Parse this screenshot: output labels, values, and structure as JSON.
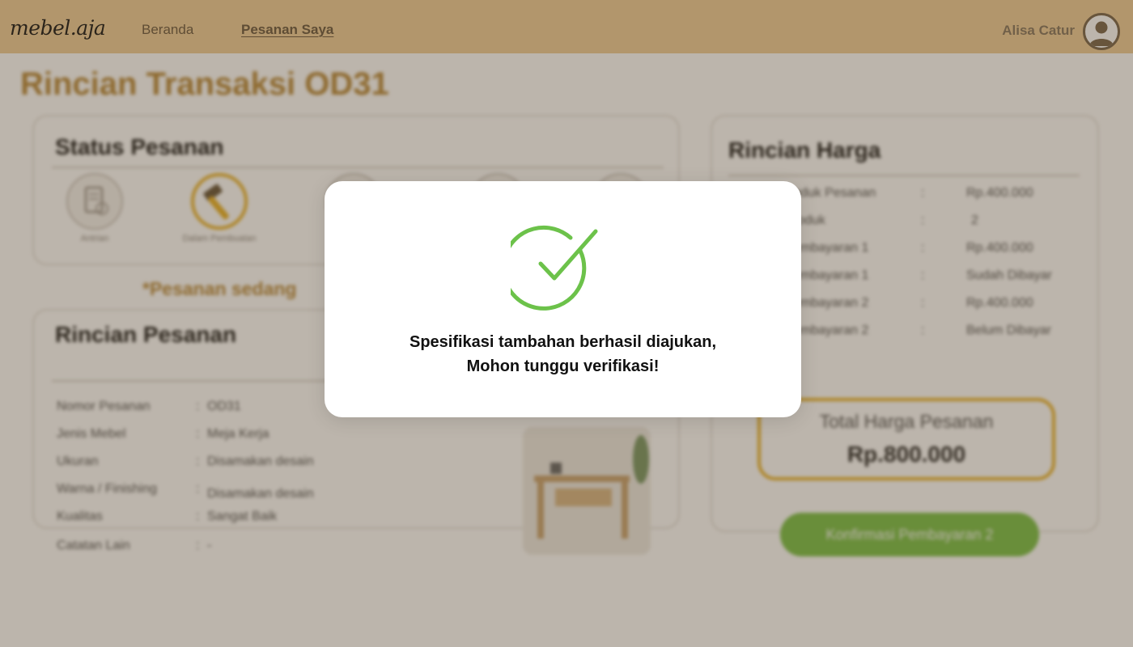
{
  "navbar": {
    "logo": "mebel.aja",
    "links": [
      "Beranda",
      "Pesanan Saya"
    ],
    "active_link": "Pesanan Saya",
    "user_name": "Alisa Catur",
    "avatar_icon": "user-avatar-icon"
  },
  "page": {
    "title": "Rincian Transaksi OD31",
    "status_card": {
      "title": "Status Pesanan",
      "steps": [
        {
          "label": "Antrian",
          "icon": "queue-icon",
          "active": false
        },
        {
          "label": "Dalam Pembuatan",
          "icon": "hammer-icon",
          "active": true
        },
        {
          "label": "",
          "icon": "step-icon",
          "active": false
        },
        {
          "label": "",
          "icon": "step-icon",
          "active": false
        },
        {
          "label": "",
          "icon": "step-icon",
          "active": false
        }
      ]
    },
    "note": "*Pesanan sedang",
    "detail_card": {
      "title": "Rincian Pesanan",
      "rows": [
        {
          "key": "Nomor Pesanan",
          "value": "OD31"
        },
        {
          "key": "Jenis Mebel",
          "value": "Meja Kerja"
        },
        {
          "key": "Ukuran",
          "value": "Disamakan desain"
        },
        {
          "key": "Warna / Finishing",
          "value": "Disamakan desain"
        },
        {
          "key": "Kualitas",
          "value": "Sangat Baik"
        },
        {
          "key": "Catatan Lain",
          "value": "-"
        }
      ]
    },
    "price_card": {
      "title": "Rincian Harga",
      "rows": [
        {
          "key": "oduk Pesanan",
          "value": "Rp.400.000"
        },
        {
          "key": "roduk",
          "value": "2"
        },
        {
          "key": "embayaran 1",
          "value": "Rp.400.000"
        },
        {
          "key": "embayaran 1",
          "value": "Sudah Dibayar"
        },
        {
          "key": "embayaran 2",
          "value": "Rp.400.000"
        },
        {
          "key": "embayaran 2",
          "value": "Belum Dibayar"
        }
      ],
      "total_label": "Total Harga Pesanan",
      "total_value": "Rp.800.000"
    },
    "confirm_button": "Konfirmasi Pembayaran 2"
  },
  "modal": {
    "icon": "check-circle-icon",
    "message_line1": "Spesifikasi tambahan berhasil diajukan,",
    "message_line2": "Mohon tunggu verifikasi!"
  },
  "colors": {
    "navbar_bg": "#f0cf9b",
    "accent_gold": "#e9b32b",
    "title_brown": "#b88a3c",
    "success_green": "#6cc24a",
    "button_green": "#7ec24d"
  }
}
